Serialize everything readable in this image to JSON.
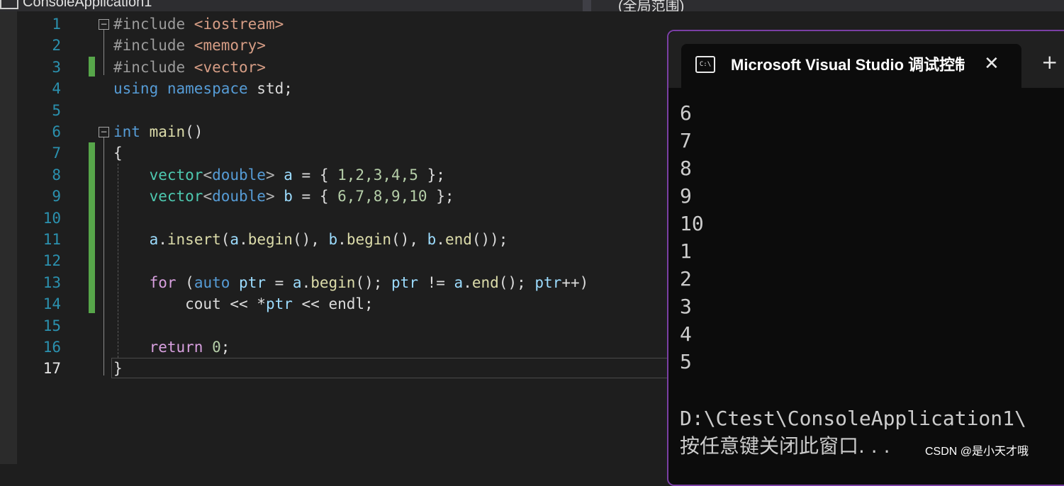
{
  "topbar": {
    "tab_left": "ConsoleApplication1",
    "tab_right": "(全局范围)"
  },
  "editor": {
    "lines": [
      {
        "num": "1",
        "tokens": [
          {
            "t": "#include ",
            "c": "pp"
          },
          {
            "t": "<iostream>",
            "c": "str"
          }
        ]
      },
      {
        "num": "2",
        "tokens": [
          {
            "t": "#include ",
            "c": "pp"
          },
          {
            "t": "<memory>",
            "c": "str"
          }
        ]
      },
      {
        "num": "3",
        "tokens": [
          {
            "t": "#include ",
            "c": "pp"
          },
          {
            "t": "<vector>",
            "c": "str"
          }
        ]
      },
      {
        "num": "4",
        "tokens": [
          {
            "t": "using namespace ",
            "c": "kw"
          },
          {
            "t": "std;",
            "c": ""
          }
        ]
      },
      {
        "num": "5",
        "tokens": []
      },
      {
        "num": "6",
        "tokens": [
          {
            "t": "int ",
            "c": "kw"
          },
          {
            "t": "main",
            "c": "fn"
          },
          {
            "t": "()",
            "c": ""
          }
        ]
      },
      {
        "num": "7",
        "tokens": [
          {
            "t": "{",
            "c": ""
          }
        ]
      },
      {
        "num": "8",
        "tokens": [
          {
            "t": "    ",
            "c": ""
          },
          {
            "t": "vector",
            "c": "ty"
          },
          {
            "t": "<",
            "c": "op"
          },
          {
            "t": "double",
            "c": "kw"
          },
          {
            "t": "> ",
            "c": "op"
          },
          {
            "t": "a",
            "c": "var"
          },
          {
            "t": " = { ",
            "c": ""
          },
          {
            "t": "1,2,3,4,5",
            "c": "num"
          },
          {
            "t": " };",
            "c": ""
          }
        ]
      },
      {
        "num": "9",
        "tokens": [
          {
            "t": "    ",
            "c": ""
          },
          {
            "t": "vector",
            "c": "ty"
          },
          {
            "t": "<",
            "c": "op"
          },
          {
            "t": "double",
            "c": "kw"
          },
          {
            "t": "> ",
            "c": "op"
          },
          {
            "t": "b",
            "c": "var"
          },
          {
            "t": " = { ",
            "c": ""
          },
          {
            "t": "6,7,8,9,10",
            "c": "num"
          },
          {
            "t": " };",
            "c": ""
          }
        ]
      },
      {
        "num": "10",
        "tokens": []
      },
      {
        "num": "11",
        "tokens": [
          {
            "t": "    ",
            "c": ""
          },
          {
            "t": "a",
            "c": "var"
          },
          {
            "t": ".",
            "c": ""
          },
          {
            "t": "insert",
            "c": "fn"
          },
          {
            "t": "(",
            "c": ""
          },
          {
            "t": "a",
            "c": "var"
          },
          {
            "t": ".",
            "c": ""
          },
          {
            "t": "begin",
            "c": "fn"
          },
          {
            "t": "(), ",
            "c": ""
          },
          {
            "t": "b",
            "c": "var"
          },
          {
            "t": ".",
            "c": ""
          },
          {
            "t": "begin",
            "c": "fn"
          },
          {
            "t": "(), ",
            "c": ""
          },
          {
            "t": "b",
            "c": "var"
          },
          {
            "t": ".",
            "c": ""
          },
          {
            "t": "end",
            "c": "fn"
          },
          {
            "t": "());",
            "c": ""
          }
        ]
      },
      {
        "num": "12",
        "tokens": []
      },
      {
        "num": "13",
        "tokens": [
          {
            "t": "    ",
            "c": ""
          },
          {
            "t": "for",
            "c": "ctl"
          },
          {
            "t": " (",
            "c": ""
          },
          {
            "t": "auto",
            "c": "kw"
          },
          {
            "t": " ",
            "c": ""
          },
          {
            "t": "ptr",
            "c": "var"
          },
          {
            "t": " = ",
            "c": ""
          },
          {
            "t": "a",
            "c": "var"
          },
          {
            "t": ".",
            "c": ""
          },
          {
            "t": "begin",
            "c": "fn"
          },
          {
            "t": "(); ",
            "c": ""
          },
          {
            "t": "ptr",
            "c": "var"
          },
          {
            "t": " != ",
            "c": ""
          },
          {
            "t": "a",
            "c": "var"
          },
          {
            "t": ".",
            "c": ""
          },
          {
            "t": "end",
            "c": "fn"
          },
          {
            "t": "(); ",
            "c": ""
          },
          {
            "t": "ptr",
            "c": "var"
          },
          {
            "t": "++)",
            "c": ""
          }
        ]
      },
      {
        "num": "14",
        "tokens": [
          {
            "t": "        cout << *",
            "c": ""
          },
          {
            "t": "ptr",
            "c": "var"
          },
          {
            "t": " << endl;",
            "c": ""
          }
        ]
      },
      {
        "num": "15",
        "tokens": []
      },
      {
        "num": "16",
        "tokens": [
          {
            "t": "    ",
            "c": ""
          },
          {
            "t": "return",
            "c": "ctl"
          },
          {
            "t": " ",
            "c": ""
          },
          {
            "t": "0",
            "c": "num"
          },
          {
            "t": ";",
            "c": ""
          }
        ]
      },
      {
        "num": "17",
        "tokens": [
          {
            "t": "}",
            "c": ""
          }
        ]
      }
    ]
  },
  "console": {
    "title": "Microsoft Visual Studio 调试控制台",
    "icon_label": "C:\\",
    "close_glyph": "✕",
    "add_glyph": "+",
    "output_lines": [
      "6",
      "7",
      "8",
      "9",
      "10",
      "1",
      "2",
      "3",
      "4",
      "5"
    ],
    "path_line": "D:\\Ctest\\ConsoleApplication1\\",
    "message_line": "按任意键关闭此窗口. . ."
  },
  "watermark": "CSDN @是小天才哦"
}
